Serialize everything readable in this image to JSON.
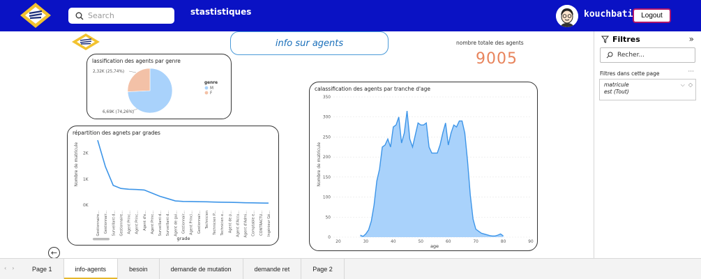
{
  "header": {
    "search_placeholder": "Search",
    "title": "stastistiques",
    "username": "kouchbati",
    "logout_label": "Logout"
  },
  "filters": {
    "title": "Filtres",
    "search_placeholder": "Recher...",
    "section_label": "Filtres dans cette page",
    "card": {
      "field": "matricule",
      "value": "est (Tout)"
    }
  },
  "report": {
    "info_title": "info sur agents",
    "kpi_label": "nombre totale des agents",
    "kpi_value": "9005"
  },
  "charts": {
    "pie_title": "lassification des agents par genre",
    "grade_title": "répartition des agnets par grades",
    "age_title": "calassification des agents par tranche d'age"
  },
  "tabs": [
    {
      "label": "Page 1",
      "active": false
    },
    {
      "label": "info-agents",
      "active": true
    },
    {
      "label": "besoin",
      "active": false
    },
    {
      "label": "demande de mutation",
      "active": false
    },
    {
      "label": "demande ret",
      "active": false
    },
    {
      "label": "Page 2",
      "active": false
    }
  ],
  "colors": {
    "header_bg": "#0a12c4",
    "accent": "#e6b82c",
    "kpi": "#e8845c",
    "series": "#3d95e8",
    "pie_m": "#a9d2fb",
    "pie_f": "#f3c1a7"
  },
  "chart_data": [
    {
      "type": "pie",
      "legend_title": "genre",
      "slices": [
        {
          "label": "M",
          "value": 6690,
          "text": "6,69K (74,26%)"
        },
        {
          "label": "F",
          "value": 2320,
          "text": "2,32K (25,74%)"
        }
      ]
    },
    {
      "type": "line",
      "xlabel": "grade",
      "ylabel": "Nombre de matricule",
      "yticks": [
        "0K",
        "1K",
        "2K"
      ],
      "ylim": [
        0,
        2500
      ],
      "categories": [
        "Gestionnaire...",
        "Gestionnair...",
        "Surveillant d...",
        "Gestionnaire...",
        "Agent Princ...",
        "Agent Princ...",
        "Agent d'e...",
        "Agent Princ...",
        "Surveillant d...",
        "Surveillant d...",
        "Agent de gui...",
        "Gestionnair...",
        "Agent Princi...",
        "Gestionnair...",
        "Technicien",
        "Technicien P...",
        "Technicien e...",
        "Agent de p...",
        "Agent d'Accu...",
        "Agent d'Admi...",
        "Comptable e...",
        "CONTRACTU...",
        "Ingénieur Gé..."
      ],
      "values": [
        2500,
        1480,
        760,
        640,
        610,
        600,
        580,
        460,
        340,
        250,
        160,
        140,
        135,
        130,
        125,
        115,
        110,
        105,
        98,
        90,
        85,
        80,
        75
      ]
    },
    {
      "type": "area",
      "xlabel": "age",
      "ylabel": "Nombre de matricule",
      "xlim": [
        20,
        90
      ],
      "ylim": [
        0,
        350
      ],
      "xticks": [
        20,
        30,
        40,
        50,
        60,
        70,
        80,
        90
      ],
      "yticks": [
        0,
        50,
        100,
        150,
        200,
        250,
        300,
        350
      ],
      "x": [
        28,
        29,
        30,
        31,
        32,
        33,
        34,
        35,
        36,
        37,
        38,
        39,
        40,
        41,
        42,
        43,
        44,
        45,
        46,
        47,
        48,
        49,
        50,
        51,
        52,
        53,
        54,
        55,
        56,
        57,
        58,
        59,
        60,
        61,
        62,
        63,
        64,
        65,
        66,
        67,
        68,
        69,
        70,
        71,
        72,
        73,
        74,
        75,
        76,
        77,
        78,
        79,
        80
      ],
      "values": [
        5,
        2,
        8,
        18,
        40,
        80,
        140,
        170,
        225,
        230,
        245,
        225,
        275,
        280,
        300,
        235,
        260,
        315,
        245,
        225,
        255,
        285,
        280,
        280,
        285,
        225,
        210,
        210,
        210,
        230,
        260,
        285,
        230,
        260,
        280,
        275,
        290,
        290,
        260,
        190,
        105,
        45,
        20,
        15,
        10,
        8,
        6,
        4,
        3,
        3,
        5,
        8,
        3
      ]
    }
  ]
}
